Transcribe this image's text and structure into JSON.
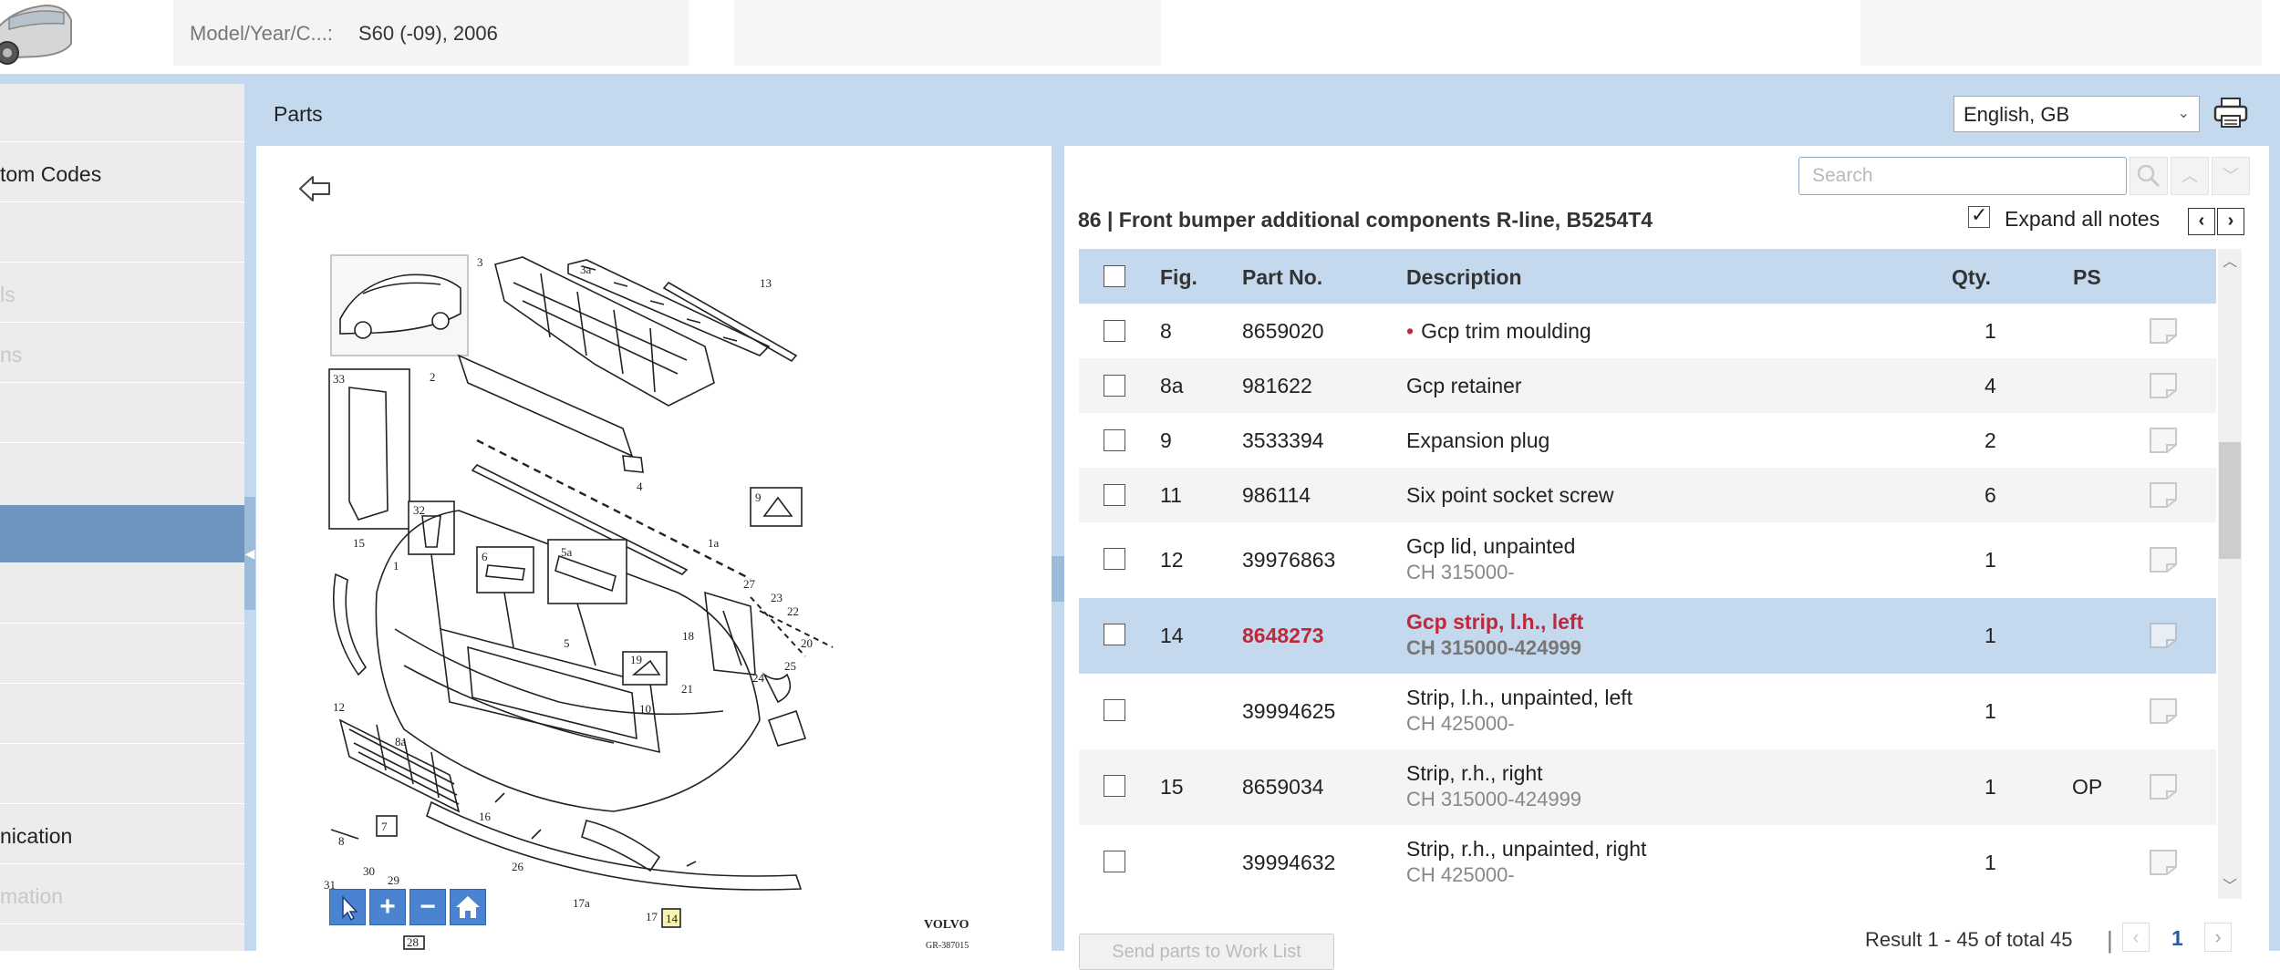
{
  "header": {
    "model_label": "Model/Year/C...:",
    "model_value": "S60 (-09), 2006"
  },
  "sidebar": {
    "items": [
      {
        "label": ""
      },
      {
        "label": "tom Codes"
      },
      {
        "label": ""
      },
      {
        "label": "ls"
      },
      {
        "label": "ns"
      },
      {
        "label": ""
      },
      {
        "label": ""
      },
      {
        "label": ""
      },
      {
        "label": ""
      },
      {
        "label": ""
      },
      {
        "label": ""
      },
      {
        "label": ""
      },
      {
        "label": "nication"
      },
      {
        "label": "mation"
      }
    ]
  },
  "parts_bar": {
    "title": "Parts",
    "language": "English, GB"
  },
  "diagram": {
    "callouts": [
      "3",
      "3a",
      "13",
      "33",
      "2",
      "4",
      "9",
      "32",
      "1a",
      "15",
      "1",
      "6",
      "5a",
      "27",
      "23",
      "22",
      "5",
      "18",
      "20",
      "19",
      "21",
      "25",
      "24",
      "10",
      "12",
      "8a",
      "16",
      "26",
      "8",
      "7",
      "31",
      "30",
      "29",
      "28",
      "17a",
      "17",
      "14"
    ],
    "brand": "VOLVO",
    "ref": "GR-387015"
  },
  "search": {
    "placeholder": "Search"
  },
  "section": {
    "title": "86  |  Front bumper additional components R-line, B5254T4",
    "expand_label": "Expand all notes"
  },
  "table": {
    "headers": {
      "fig": "Fig.",
      "part_no": "Part No.",
      "description": "Description",
      "qty": "Qty.",
      "ps": "PS"
    },
    "rows": [
      {
        "fig": "8",
        "part_no": "8659020",
        "description": "Gcp trim moulding",
        "sub": "",
        "qty": "1",
        "ps": "",
        "bullet": "•"
      },
      {
        "fig": "8a",
        "part_no": "981622",
        "description": "Gcp retainer",
        "sub": "",
        "qty": "4",
        "ps": ""
      },
      {
        "fig": "9",
        "part_no": "3533394",
        "description": "Expansion plug",
        "sub": "",
        "qty": "2",
        "ps": ""
      },
      {
        "fig": "11",
        "part_no": "986114",
        "description": "Six point socket screw",
        "sub": "",
        "qty": "6",
        "ps": ""
      },
      {
        "fig": "12",
        "part_no": "39976863",
        "description": "Gcp lid, unpainted",
        "sub": "CH 315000-",
        "qty": "1",
        "ps": ""
      },
      {
        "fig": "14",
        "part_no": "8648273",
        "description": "Gcp strip, l.h., left",
        "sub": "CH 315000-424999",
        "qty": "1",
        "ps": ""
      },
      {
        "fig": "",
        "part_no": "39994625",
        "description": "Strip, l.h., unpainted, left",
        "sub": "CH 425000-",
        "qty": "1",
        "ps": ""
      },
      {
        "fig": "15",
        "part_no": "8659034",
        "description": "Strip, r.h., right",
        "sub": "CH 315000-424999",
        "qty": "1",
        "ps": "OP"
      },
      {
        "fig": "",
        "part_no": "39994632",
        "description": "Strip, r.h., unpainted, right",
        "sub": "CH 425000-",
        "qty": "1",
        "ps": ""
      }
    ]
  },
  "footer": {
    "button_label": "Send parts to Work List",
    "result": "Result 1 - 45 of total 45",
    "page": "1"
  },
  "colors": {
    "frame_blue": "#c4d9ee",
    "active_side": "#6d95c0",
    "highlight_red": "#c0283a",
    "tool_blue": "#4a83cf"
  }
}
